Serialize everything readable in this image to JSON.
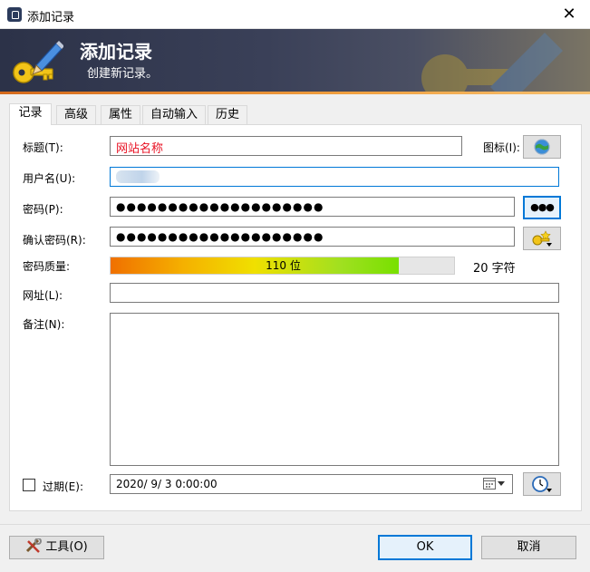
{
  "window": {
    "title": "添加记录",
    "close_glyph": "✕"
  },
  "banner": {
    "heading": "添加记录",
    "subheading": "创建新记录。"
  },
  "tabs": [
    "记录",
    "高级",
    "属性",
    "自动输入",
    "历史"
  ],
  "form": {
    "title_label": "标题(T):",
    "title_value": "网站名称",
    "icon_label": "图标(I):",
    "username_label": "用户名(U):",
    "password_label": "密码(P):",
    "password_value": "●●●●●●●●●●●●●●●●●●●●",
    "confirm_label": "确认密码(R):",
    "confirm_value": "●●●●●●●●●●●●●●●●●●●●",
    "show_password_glyph": "●●●",
    "quality_label": "密码质量:",
    "quality_bits_text": "110 位",
    "quality_fraction": 0.84,
    "quality_chars_text": "20 字符",
    "url_label": "网址(L):",
    "url_value": "",
    "notes_label": "备注(N):",
    "notes_value": "",
    "expires_label": "过期(E):",
    "expires_value": "2020/  9/  3   0:00:00"
  },
  "footer": {
    "tools_label": "工具(O)",
    "ok_label": "OK",
    "cancel_label": "取消"
  },
  "colors": {
    "accent": "#0078d7",
    "title_red": "#e81123",
    "banner_dark": "#2c3248",
    "banner_orange": "#d4691c"
  }
}
